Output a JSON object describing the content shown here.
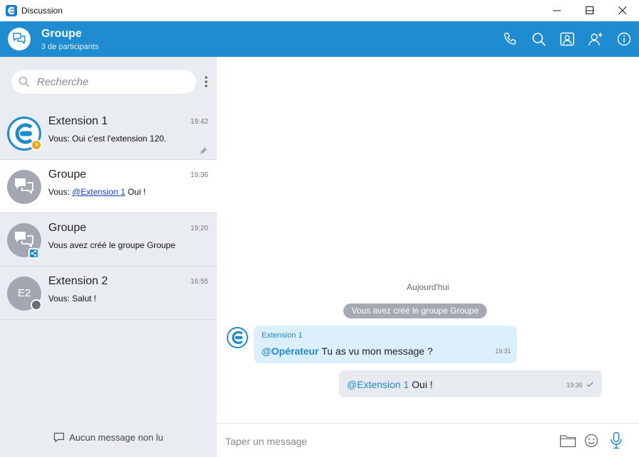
{
  "window": {
    "title": "Discussion",
    "controls": [
      "minimize",
      "maximize",
      "close"
    ]
  },
  "header": {
    "title": "Groupe",
    "subtitle": "3 de participants",
    "icons": [
      "phone-icon",
      "search-icon",
      "contact-card-icon",
      "add-user-icon",
      "info-icon"
    ],
    "background": "#1f8bd0"
  },
  "sidebar": {
    "search_placeholder": "Recherche",
    "conversations": [
      {
        "name": "Extension 1",
        "time": "19:42",
        "preview": "Vous: Oui c'est l'extension 120.",
        "status": "away",
        "pinned": true
      },
      {
        "name": "Groupe",
        "time": "19:36",
        "preview_prefix": "Vous: ",
        "preview_mention": "@Extension 1",
        "preview_suffix": " Oui !"
      },
      {
        "name": "Groupe",
        "time": "19:20",
        "preview": "Vous avez créé le groupe Groupe",
        "badge": "share"
      },
      {
        "name": "Extension 2",
        "initials": "E2",
        "time": "16:55",
        "preview": "Vous: Salut !",
        "status": "offline"
      }
    ],
    "footer_text": "Aucun message non lu"
  },
  "chat": {
    "date_separator": "Aujourd'hui",
    "system_message": "Vous avez créé le groupe Groupe",
    "messages": [
      {
        "author": "Extension 1",
        "mention": "@Opérateur",
        "text": " Tu as vu mon message ?",
        "time": "19:31",
        "direction": "in"
      },
      {
        "mention": "@Extension 1",
        "text": " Oui !",
        "time": "19:36",
        "direction": "out",
        "read": true
      }
    ]
  },
  "composer": {
    "placeholder": "Taper un message",
    "icons": [
      "folder-icon",
      "emoji-icon",
      "microphone-icon"
    ]
  },
  "colors": {
    "accent": "#1f8bd0",
    "sidebar_bg": "#e9ecf1",
    "incoming_bubble": "#dbeffc",
    "outgoing_bubble": "#e7eaef",
    "away": "#f5a623"
  }
}
